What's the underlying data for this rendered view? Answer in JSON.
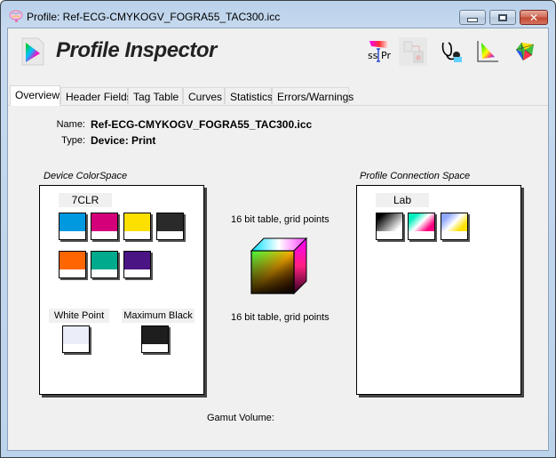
{
  "window": {
    "title": "Profile: Ref-ECG-CMYKOGV_FOGRA55_TAC300.icc",
    "buttons": {
      "minimize": "minimize",
      "maximize": "maximize",
      "close": "close"
    }
  },
  "header": {
    "app_title": "Profile Inspector",
    "toolbar": [
      {
        "name": "spectral-profile-icon",
        "label": "ss|Pr"
      },
      {
        "name": "device-link-icon",
        "disabled": true
      },
      {
        "name": "stethoscope-icon"
      },
      {
        "name": "gamut-plot-icon"
      },
      {
        "name": "3d-gamut-icon"
      }
    ]
  },
  "tabs": [
    {
      "label": "Overview",
      "active": true
    },
    {
      "label": "Header Fields"
    },
    {
      "label": "Tag Table"
    },
    {
      "label": "Curves"
    },
    {
      "label": "Statistics"
    },
    {
      "label": "Errors/Warnings"
    }
  ],
  "overview": {
    "name_label": "Name:",
    "name_value": "Ref-ECG-CMYKOGV_FOGRA55_TAC300.icc",
    "type_label": "Type:",
    "type_value": "Device: Print",
    "device_space": {
      "title": "Device ColorSpace",
      "colorspace": "7CLR",
      "colorants": [
        "#0099e0",
        "#d4007a",
        "#fde000",
        "#2a2a2a",
        "#ff6600",
        "#00aa8c",
        "#4b1485"
      ],
      "white_point_label": "White Point",
      "white_point_color": "#ebeef9",
      "max_black_label": "Maximum Black",
      "max_black_color": "#1e1e1e"
    },
    "transform": {
      "top_text": "16 bit table,  grid points",
      "bottom_text": "16 bit table,  grid points"
    },
    "pcs": {
      "title": "Profile Connection Space",
      "colorspace": "Lab"
    },
    "gamut_volume_label": "Gamut Volume:"
  }
}
